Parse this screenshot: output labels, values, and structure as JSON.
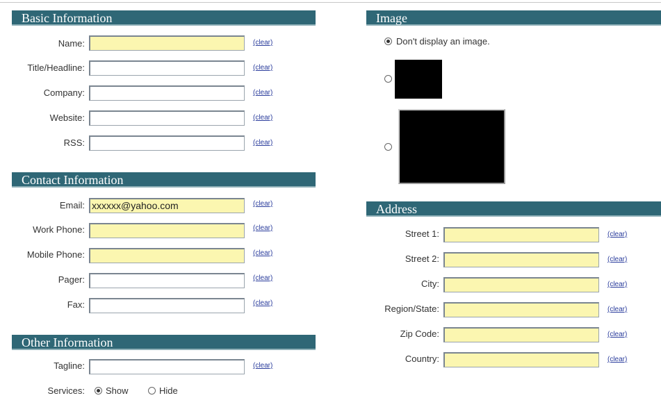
{
  "clear_label": "(clear)",
  "basic": {
    "title": "Basic Information",
    "fields": [
      {
        "label": "Name:",
        "value": ""
      },
      {
        "label": "Title/Headline:",
        "value": ""
      },
      {
        "label": "Company:",
        "value": ""
      },
      {
        "label": "Website:",
        "value": ""
      },
      {
        "label": "RSS:",
        "value": ""
      }
    ]
  },
  "contact": {
    "title": "Contact Information",
    "fields": [
      {
        "label": "Email:",
        "value": "xxxxxx@yahoo.com"
      },
      {
        "label": "Work Phone:",
        "value": ""
      },
      {
        "label": "Mobile Phone:",
        "value": ""
      },
      {
        "label": "Pager:",
        "value": ""
      },
      {
        "label": "Fax:",
        "value": ""
      }
    ]
  },
  "other": {
    "title": "Other Information",
    "tagline_label": "Tagline:",
    "tagline_value": "",
    "services_label": "Services:",
    "services_show": "Show",
    "services_hide": "Hide",
    "services_selected": "Show"
  },
  "image": {
    "title": "Image",
    "no_image_option": "Don't display an image.",
    "selected": "none"
  },
  "address": {
    "title": "Address",
    "fields": [
      {
        "label": "Street 1:",
        "value": ""
      },
      {
        "label": "Street 2:",
        "value": ""
      },
      {
        "label": "City:",
        "value": ""
      },
      {
        "label": "Region/State:",
        "value": ""
      },
      {
        "label": "Zip Code:",
        "value": ""
      },
      {
        "label": "Country:",
        "value": ""
      }
    ]
  },
  "colors": {
    "header_bg": "#2f6776",
    "highlight_field": "#fbf6b0",
    "link": "#2a3c9c"
  }
}
